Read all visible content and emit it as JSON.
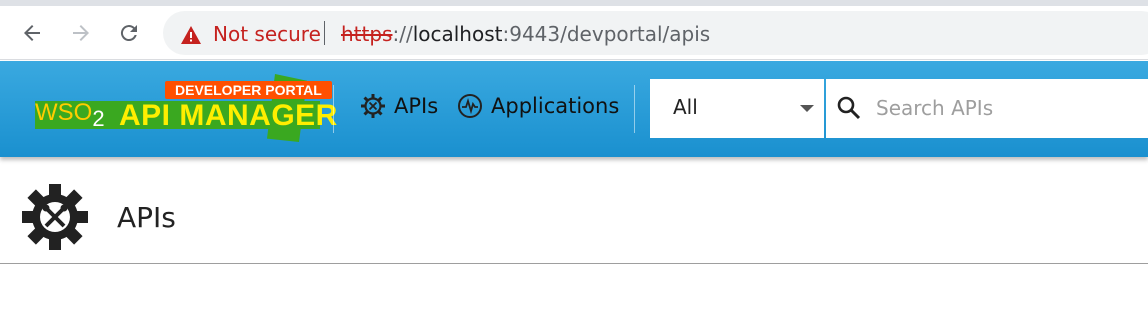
{
  "browser": {
    "security_label": "Not secure",
    "url_scheme": "https",
    "url_sep": "://",
    "url_host": "localhost",
    "url_rest": ":9443/devportal/apis"
  },
  "header": {
    "badge": "DEVELOPER PORTAL",
    "logo_wso": "WSO",
    "logo_sub": "2",
    "logo_product": "API MANAGER",
    "nav": [
      {
        "label": "APIs",
        "icon": "gear-tools-icon"
      },
      {
        "label": "Applications",
        "icon": "pulse-icon"
      }
    ],
    "filter_selected": "All",
    "search_placeholder": "Search APIs"
  },
  "page": {
    "title": "APIs",
    "title_icon": "api-gear-icon"
  },
  "colors": {
    "header_blue": "#1a90cf",
    "badge_orange": "#ff5000",
    "logo_yellow": "#ffee00",
    "insecure_red": "#c5221f"
  }
}
